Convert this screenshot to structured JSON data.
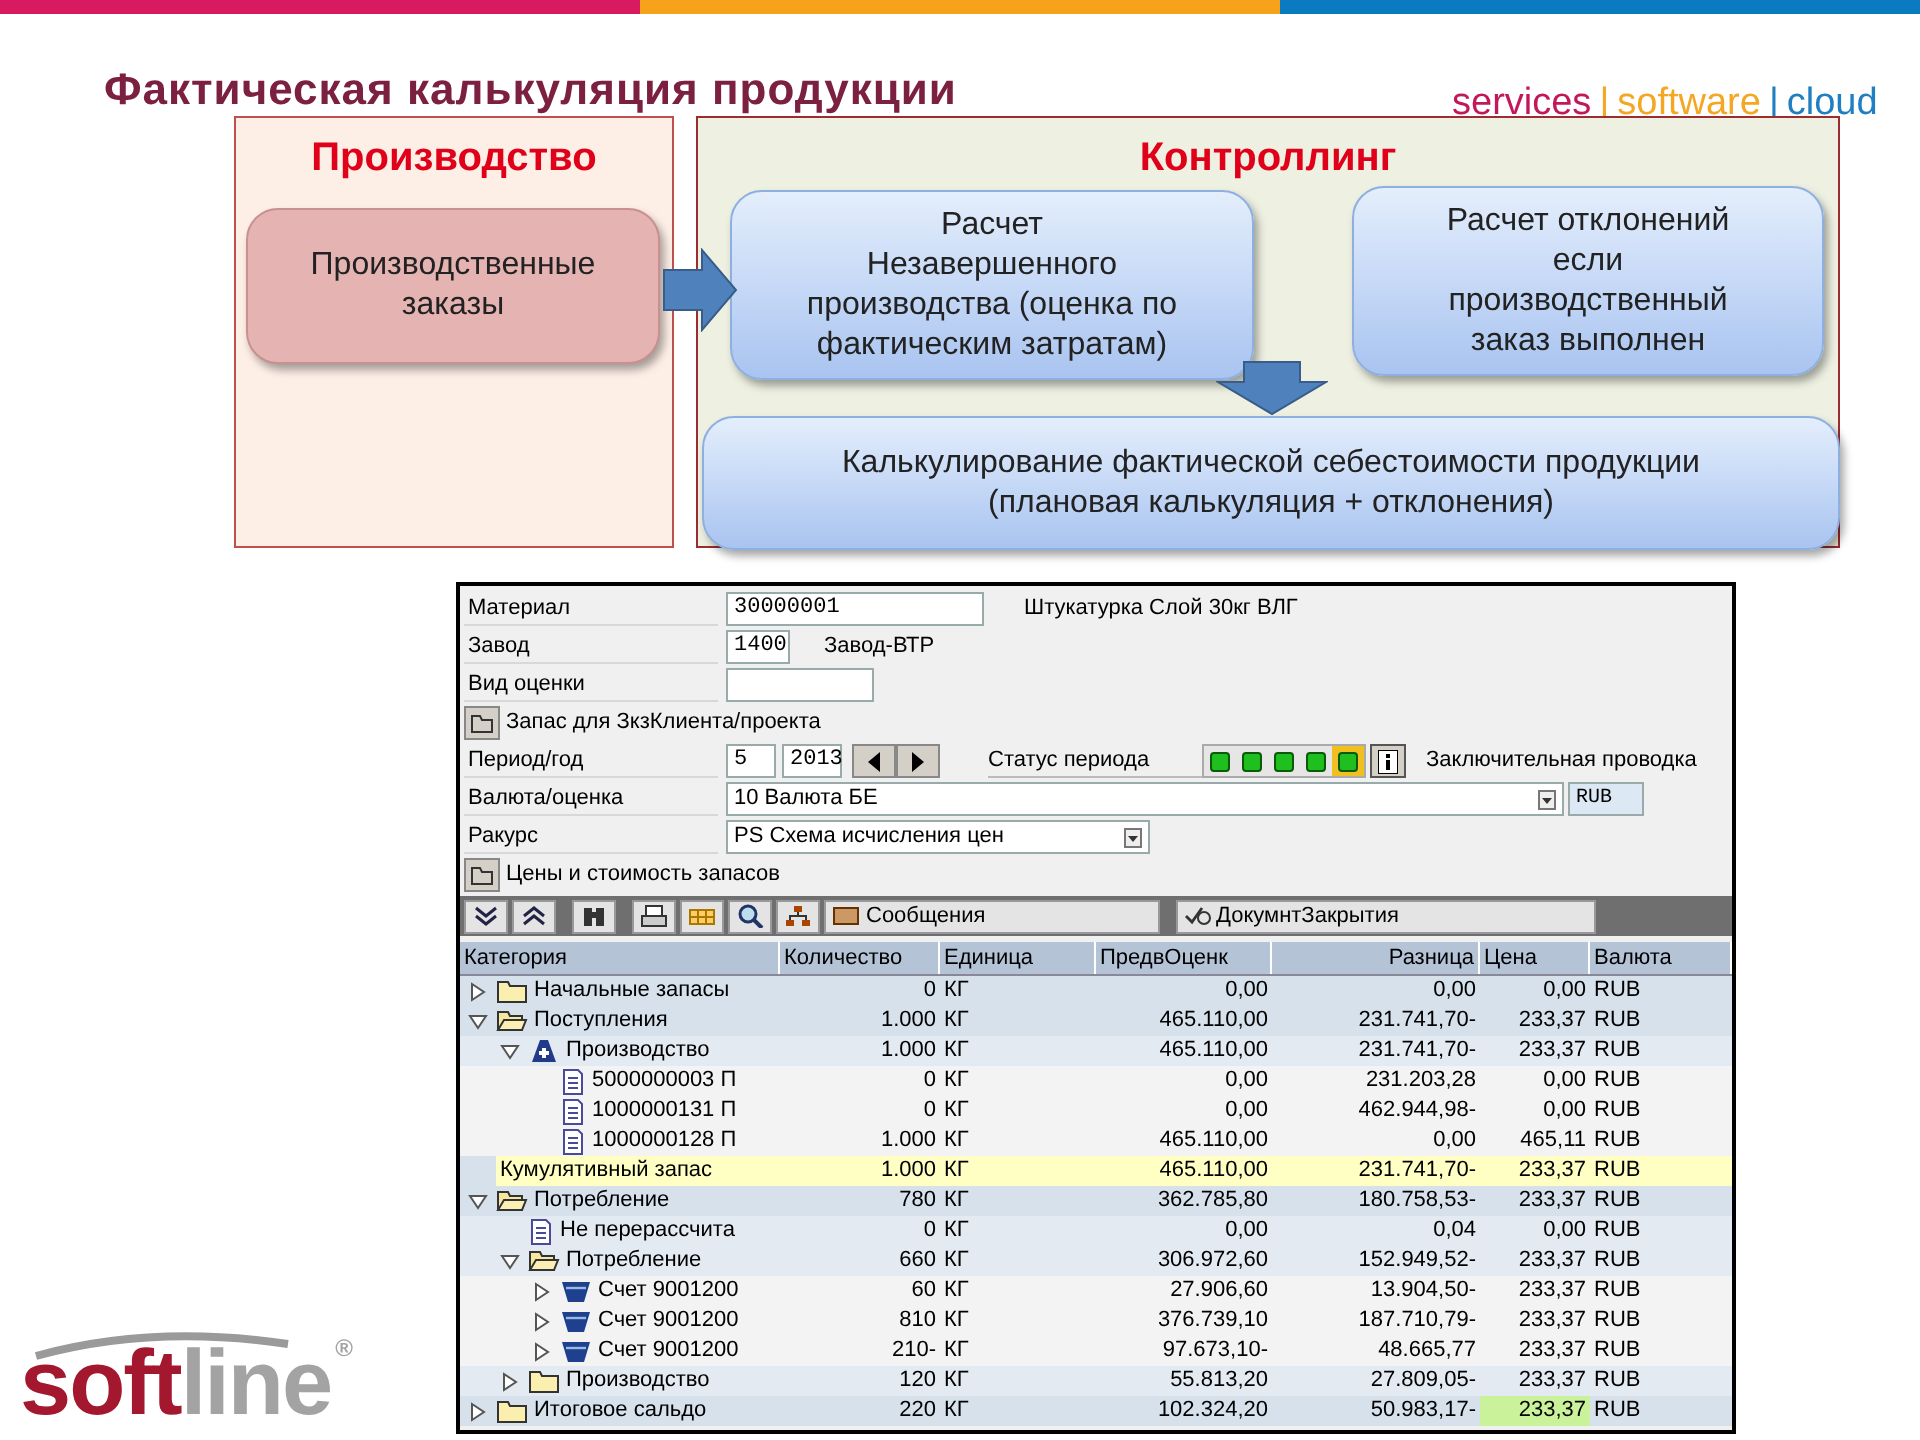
{
  "title": "Фактическая калькуляция продукции",
  "tagline": [
    {
      "text": "services",
      "color": "#c2185b"
    },
    {
      "text": "|",
      "color": "#f5a623"
    },
    {
      "text": "software",
      "color": "#f5a623"
    },
    {
      "text": "|",
      "color": "#1f7fc0"
    },
    {
      "text": "cloud",
      "color": "#1f7fc0"
    }
  ],
  "diagram": {
    "panels": [
      {
        "title": "Производство",
        "kind": "production"
      },
      {
        "title": "Контроллинг",
        "kind": "controlling"
      }
    ],
    "nodes": [
      {
        "text": "Производственные\nзаказы",
        "kind": "order"
      },
      {
        "text": "Расчет\nНезавершенного\nпроизводства (оценка по\nфактическим затратам)",
        "kind": "wip"
      },
      {
        "text": "Расчет отклонений\nесли\nпроизводственный\nзаказ выполнен",
        "kind": "variance"
      },
      {
        "text": "Калькулирование фактической себестоимости продукции\n(плановая калькуляция + отклонения)",
        "kind": "result"
      }
    ]
  },
  "sap": {
    "material": {
      "label": "Материал",
      "value": "30000001",
      "description": "Штукатурка Слой 30кг ВЛГ"
    },
    "plant": {
      "label": "Завод",
      "value": "1400",
      "description": "Завод-ВТР"
    },
    "valuation_type": {
      "label": "Вид оценки"
    },
    "section_1": {
      "label": "Запас для ЗкзКлиента/проекта"
    },
    "period": {
      "label": "Период/год",
      "period": "5",
      "year": "2013",
      "status_label": "Статус периода",
      "lights": [
        {
          "selected": false
        },
        {
          "selected": false
        },
        {
          "selected": false
        },
        {
          "selected": false
        },
        {
          "selected": true
        }
      ],
      "closing": "Заключительная проводка"
    },
    "currency": {
      "label": "Валюта/оценка",
      "value": "10 Валюта БЕ",
      "unit": "RUB"
    },
    "view": {
      "label": "Ракурс",
      "value": "PS Схема исчисления цен"
    },
    "section_2": {
      "label": "Цены и стоимость запасов"
    },
    "toolbar": {
      "messages": "Сообщения",
      "closing_doc": "ДокумнтЗакрытия"
    },
    "table": {
      "columns": [
        "Категория",
        "Количество",
        "Единица",
        "ПредвОценк",
        "Разница",
        "Цена",
        "Валюта"
      ],
      "rows": [
        {
          "kind": "folder",
          "expanded": false,
          "cells": [
            "Начальные запасы",
            "0",
            "КГ",
            "0,00",
            "0,00",
            "0,00",
            "RUB"
          ]
        },
        {
          "kind": "folder",
          "expanded": true,
          "cells": [
            "Поступления",
            "1.000",
            "КГ",
            "465.110,00",
            "231.741,70-",
            "233,37",
            "RUB"
          ],
          "children": [
            {
              "kind": "production",
              "expanded": true,
              "cells": [
                "Производство",
                "1.000",
                "КГ",
                "465.110,00",
                "231.741,70-",
                "233,37",
                "RUB"
              ],
              "children": [
                {
                  "kind": "document",
                  "cells": [
                    "5000000003 П",
                    "0",
                    "КГ",
                    "0,00",
                    "231.203,28",
                    "0,00",
                    "RUB"
                  ]
                },
                {
                  "kind": "document",
                  "cells": [
                    "1000000131 П",
                    "0",
                    "КГ",
                    "0,00",
                    "462.944,98-",
                    "0,00",
                    "RUB"
                  ]
                },
                {
                  "kind": "document",
                  "cells": [
                    "1000000128 П",
                    "1.000",
                    "КГ",
                    "465.110,00",
                    "0,00",
                    "465,11",
                    "RUB"
                  ]
                }
              ]
            }
          ]
        },
        {
          "kind": "total",
          "cells": [
            "Кумулятивный запас",
            "1.000",
            "КГ",
            "465.110,00",
            "231.741,70-",
            "233,37",
            "RUB"
          ]
        },
        {
          "kind": "folder",
          "expanded": true,
          "cells": [
            "Потребление",
            "780",
            "КГ",
            "362.785,80",
            "180.758,53-",
            "233,37",
            "RUB"
          ],
          "children": [
            {
              "kind": "document",
              "cells": [
                "Не перерассчита",
                "0",
                "КГ",
                "0,00",
                "0,04",
                "0,00",
                "RUB"
              ]
            },
            {
              "kind": "folder",
              "expanded": true,
              "cells": [
                "Потребление",
                "660",
                "КГ",
                "306.972,60",
                "152.949,52-",
                "233,37",
                "RUB"
              ],
              "children": [
                {
                  "kind": "account",
                  "expanded": false,
                  "cells": [
                    "Счет 9001200",
                    "60",
                    "КГ",
                    "27.906,60",
                    "13.904,50-",
                    "233,37",
                    "RUB"
                  ]
                },
                {
                  "kind": "account",
                  "expanded": false,
                  "cells": [
                    "Счет 9001200",
                    "810",
                    "КГ",
                    "376.739,10",
                    "187.710,79-",
                    "233,37",
                    "RUB"
                  ]
                },
                {
                  "kind": "account",
                  "expanded": false,
                  "cells": [
                    "Счет 9001200",
                    "210-",
                    "КГ",
                    "97.673,10-",
                    "48.665,77",
                    "233,37",
                    "RUB"
                  ]
                }
              ]
            },
            {
              "kind": "folder",
              "expanded": false,
              "cells": [
                "Производство",
                "120",
                "КГ",
                "55.813,20",
                "27.809,05-",
                "233,37",
                "RUB"
              ]
            }
          ]
        },
        {
          "kind": "folder",
          "expanded": false,
          "price_highlight": true,
          "cells": [
            "Итоговое сальдо",
            "220",
            "КГ",
            "102.324,20",
            "50.983,17-",
            "233,37",
            "RUB"
          ]
        }
      ]
    }
  },
  "logo": {
    "left": "soft",
    "right": "line",
    "registered": "®"
  }
}
